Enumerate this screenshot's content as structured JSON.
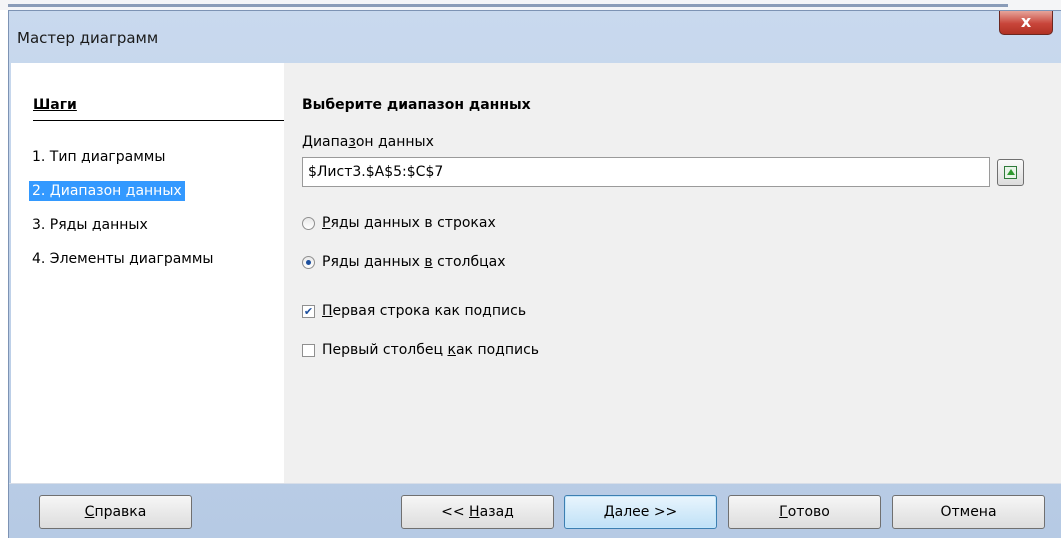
{
  "window": {
    "title": "Мастер диаграмм",
    "close_glyph": "x"
  },
  "steps": {
    "header": "Шаги",
    "items": [
      {
        "label": "1. Тип диаграммы",
        "selected": false
      },
      {
        "label": "2. Диапазон данных",
        "selected": true
      },
      {
        "label": "3. Ряды данных",
        "selected": false
      },
      {
        "label": "4. Элементы диаграммы",
        "selected": false
      }
    ]
  },
  "main": {
    "section_title": "Выберите диапазон данных",
    "range_label": {
      "pre": "Диапа",
      "key": "з",
      "post": "он данных"
    },
    "range_value": "$Лист3.$A$5:$C$7",
    "rows_option": {
      "pre": "",
      "key": "Р",
      "post": "яды данных в строках",
      "checked": false
    },
    "cols_option": {
      "pre": "Ряды данных ",
      "key": "в",
      "post": " столбцах",
      "checked": true
    },
    "first_row_label": {
      "pre": "",
      "key": "П",
      "post": "ервая строка как подпись",
      "checked": true
    },
    "first_col_label": {
      "pre": "Первый столбец ",
      "key": "к",
      "post": "ак подпись",
      "checked": false
    }
  },
  "buttons": {
    "help": {
      "key": "С",
      "post": "правка"
    },
    "back": {
      "pre": "<< ",
      "key": "Н",
      "post": "азад"
    },
    "next": {
      "key": "Д",
      "post": "алее >>"
    },
    "finish": {
      "key": "Г",
      "post": "отово"
    },
    "cancel": "Отмена"
  },
  "colors": {
    "selection": "#3399ff",
    "frame": "#b9cde6",
    "close": "#c8453a"
  }
}
